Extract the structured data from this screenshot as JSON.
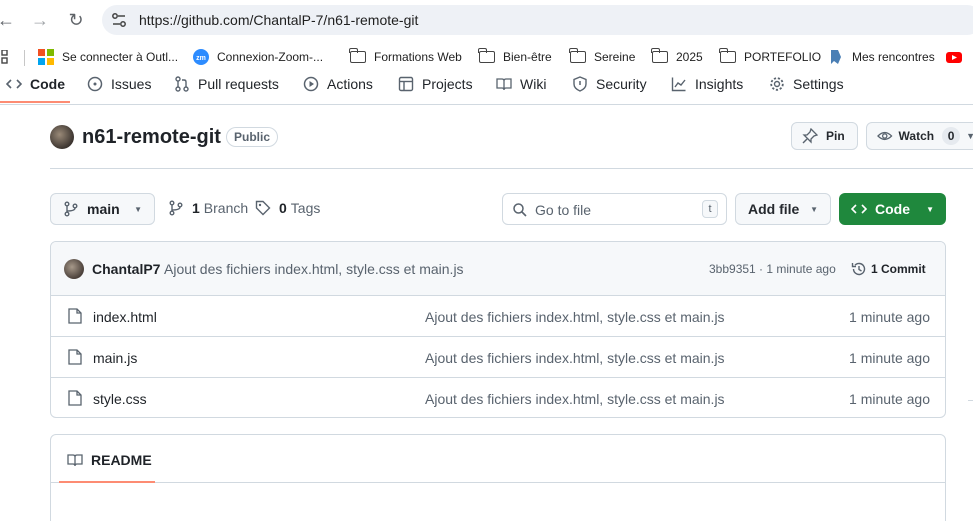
{
  "browser": {
    "url": "https://github.com/ChantalP-7/n61-remote-git",
    "bookmarks": [
      {
        "label": "Se connecter à Outl...",
        "icon": "microsoft-icon"
      },
      {
        "label": "Connexion-Zoom-...",
        "icon": "zoom-icon"
      },
      {
        "label": "Formations Web",
        "icon": "folder-icon"
      },
      {
        "label": "Bien-être",
        "icon": "folder-icon"
      },
      {
        "label": "Sereine",
        "icon": "folder-icon"
      },
      {
        "label": "2025",
        "icon": "folder-icon"
      },
      {
        "label": "PORTEFOLIO",
        "icon": "folder-icon"
      },
      {
        "label": "Mes rencontres",
        "icon": "bookmark-icon"
      }
    ]
  },
  "repo_nav": {
    "tabs": [
      "Code",
      "Issues",
      "Pull requests",
      "Actions",
      "Projects",
      "Wiki",
      "Security",
      "Insights",
      "Settings"
    ],
    "active": "Code"
  },
  "repo": {
    "name": "n61-remote-git",
    "visibility": "Public",
    "pin_label": "Pin",
    "watch_label": "Watch",
    "watch_count": "0"
  },
  "toolbar": {
    "branch": "main",
    "branches_count": "1",
    "branches_label": "Branch",
    "tags_count": "0",
    "tags_label": "Tags",
    "goto_placeholder": "Go to file",
    "goto_shortcut": "t",
    "add_file_label": "Add file",
    "code_label": "Code"
  },
  "latest_commit": {
    "author": "ChantalP7",
    "message": "Ajout des fichiers index.html, style.css et main.js",
    "hash_time": "3bb9351 · 1 minute ago",
    "commit_count": "1 Commit"
  },
  "files": [
    {
      "name": "index.html",
      "message": "Ajout des fichiers index.html, style.css et main.js",
      "time": "1 minute ago"
    },
    {
      "name": "main.js",
      "message": "Ajout des fichiers index.html, style.css et main.js",
      "time": "1 minute ago"
    },
    {
      "name": "style.css",
      "message": "Ajout des fichiers index.html, style.css et main.js",
      "time": "1 minute ago"
    }
  ],
  "readme": {
    "title": "README"
  },
  "colors": {
    "accent_orange": "#fd8c73",
    "code_button_green": "#1f883d",
    "border": "#d1d9e0"
  }
}
